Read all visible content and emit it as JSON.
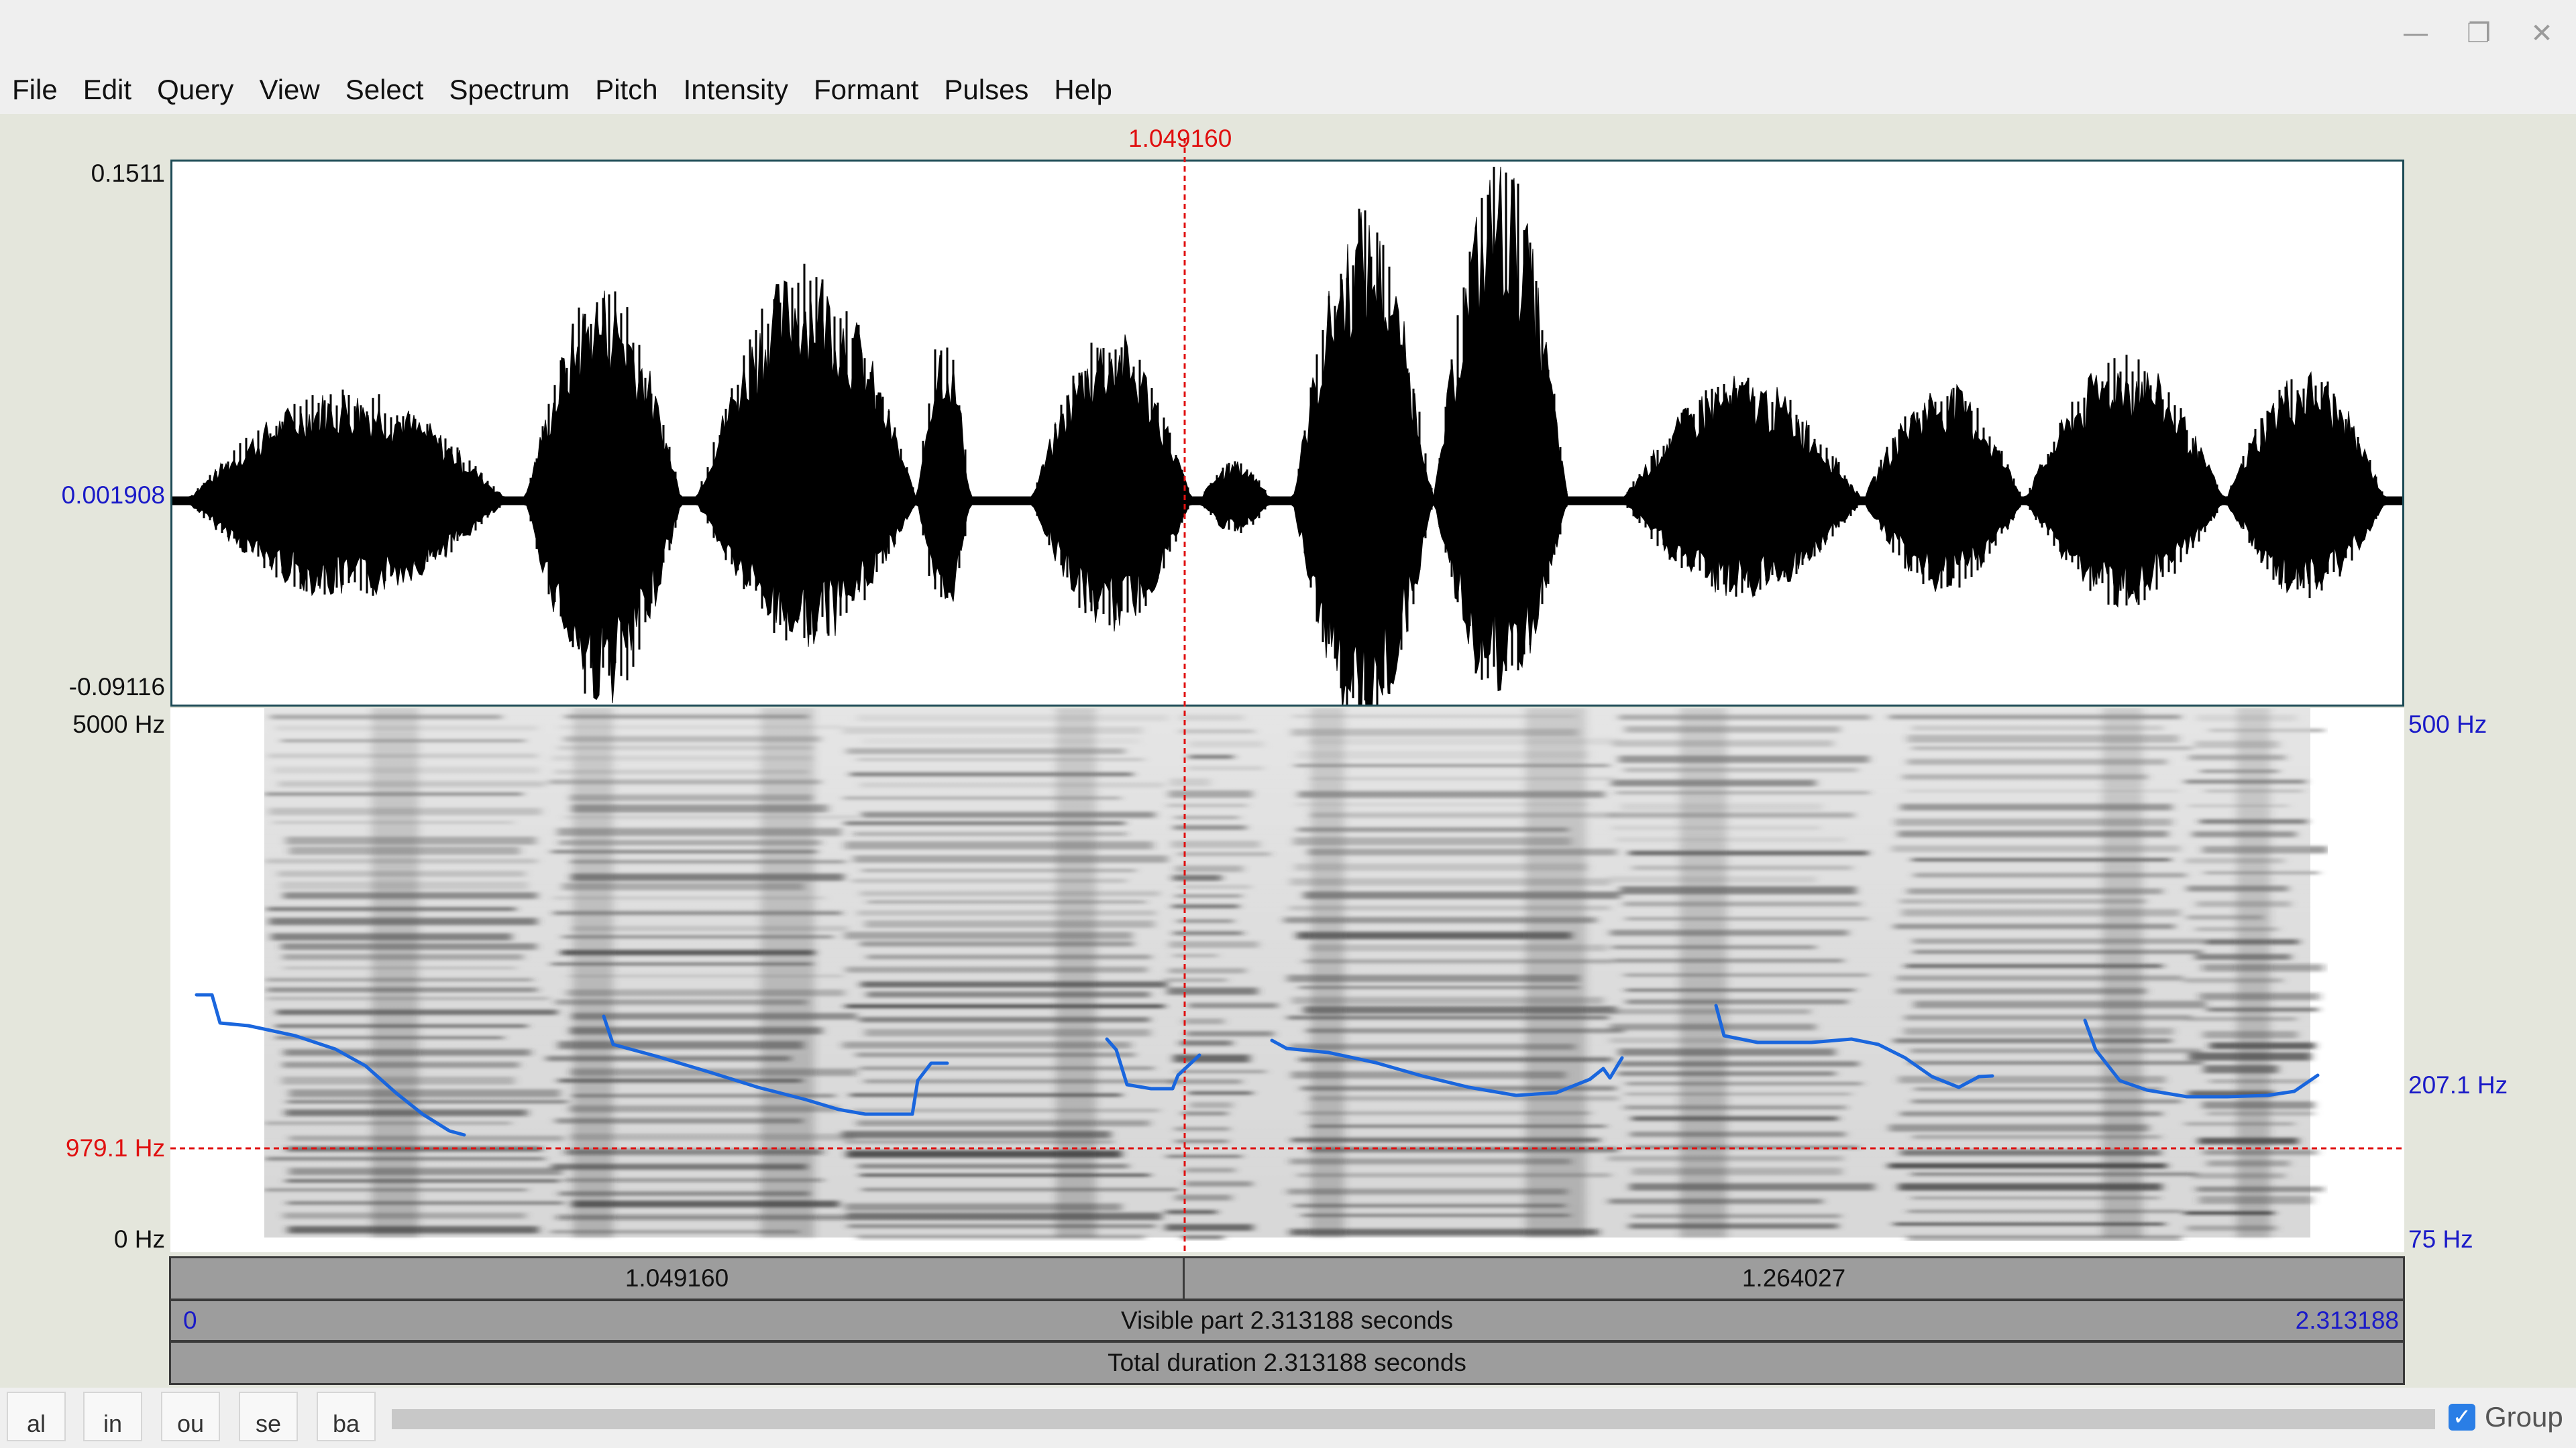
{
  "window": {
    "minimize_glyph": "—",
    "maximize_glyph": "❐",
    "close_glyph": "✕"
  },
  "menu": [
    "File",
    "Edit",
    "Query",
    "View",
    "Select",
    "Spectrum",
    "Pitch",
    "Intensity",
    "Formant",
    "Pulses",
    "Help"
  ],
  "cursor_time": "1.049160",
  "waveform": {
    "max_label": "0.1511",
    "center_label": "0.001908",
    "min_label": "-0.09116"
  },
  "spectrogram": {
    "top_label": "5000 Hz",
    "cursor_freq_label": "979.1 Hz",
    "bottom_label": "0 Hz"
  },
  "pitch": {
    "top_label": "500 Hz",
    "value_label": "207.1 Hz",
    "bottom_label": "75 Hz"
  },
  "time_bar": {
    "left_segment": "1.049160",
    "right_segment": "1.264027"
  },
  "visible_bar": {
    "start": "0",
    "text": "Visible part 2.313188 seconds",
    "end": "2.313188"
  },
  "total_bar": {
    "text": "Total duration 2.313188 seconds"
  },
  "zoom_buttons": [
    "al",
    "in",
    "ou",
    "se",
    "ba"
  ],
  "group": {
    "label": "Group",
    "checked": true
  },
  "colors": {
    "pitch_line": "#1a66dd",
    "cursor": "#e01010",
    "axis_blue": "#1a1ac8"
  },
  "icons": [
    "minimize-icon",
    "maximize-icon",
    "close-icon",
    "checkbox-checked-icon"
  ]
}
